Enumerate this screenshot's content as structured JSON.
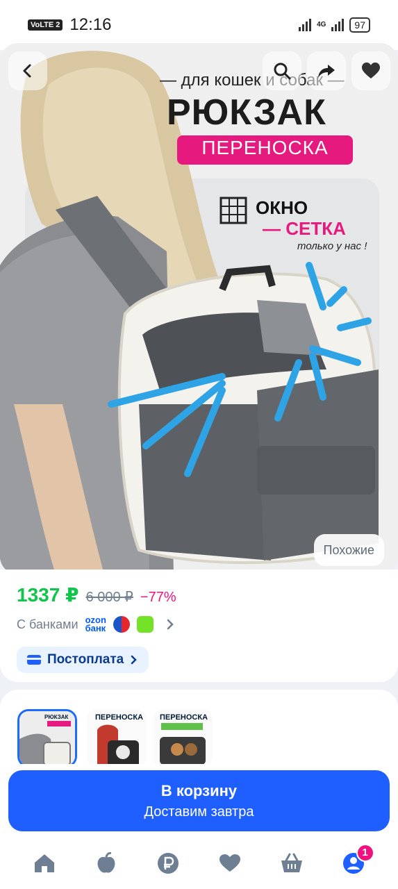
{
  "status_bar": {
    "volte": "VoLTE 2",
    "time": "12:16",
    "network": "4G",
    "battery": "97"
  },
  "product": {
    "banner": {
      "subtitle": "— для кошек и собак —",
      "title": "РЮКЗАК",
      "tag": "ПЕРЕНОСКА",
      "feature_line1": "ОКНО",
      "feature_line2": "— СЕТКА",
      "feature_note": "только у нас !"
    },
    "similar_label": "Похожие",
    "price": "1337 ₽",
    "old_price": "6 000 ₽",
    "discount": "−77%",
    "banks_label": "С банками",
    "ozon_bank_line1": "ozon",
    "ozon_bank_line2": "банк",
    "postpay_label": "Постоплата",
    "thumbnails": [
      {
        "caption": "РЮКЗАК"
      },
      {
        "caption": "ПЕРЕНОСКА"
      },
      {
        "caption": "ПЕРЕНОСКА"
      }
    ]
  },
  "cart": {
    "button_label": "В корзину",
    "delivery": "Доставим завтра"
  },
  "nav": {
    "items": [
      {
        "icon": "home-icon"
      },
      {
        "icon": "fresh-icon"
      },
      {
        "icon": "ruble-icon"
      },
      {
        "icon": "heart-icon"
      },
      {
        "icon": "basket-icon"
      },
      {
        "icon": "profile-icon"
      }
    ],
    "profile_badge": "1"
  },
  "colors": {
    "accent": "#1f5fff",
    "price_green": "#10c44c",
    "discount_pink": "#f1117e"
  }
}
